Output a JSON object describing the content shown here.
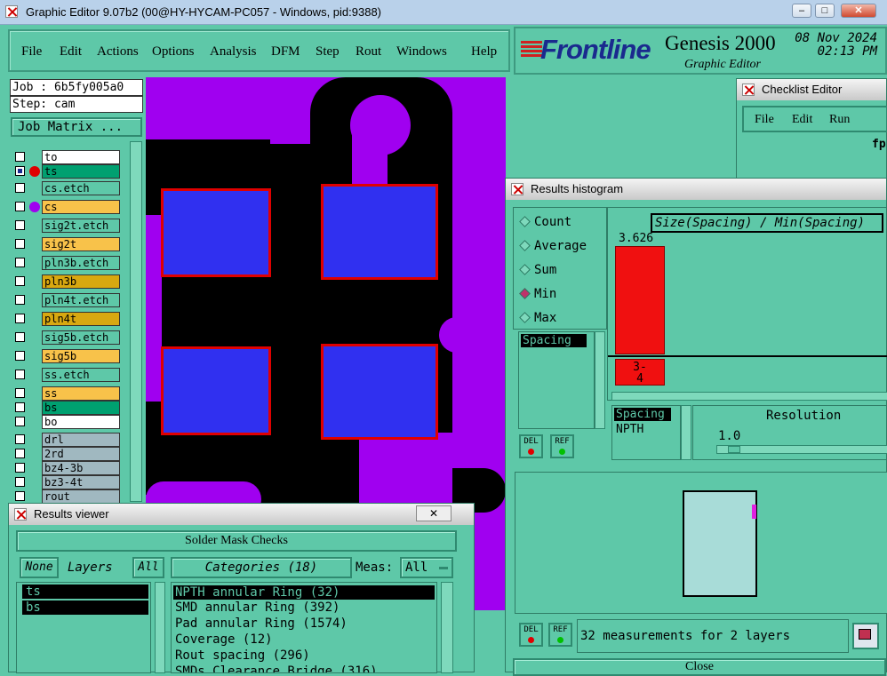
{
  "window": {
    "title": "Graphic Editor 9.07b2 (00@HY-HYCAM-PC057 - Windows, pid:9388)"
  },
  "menu": {
    "items": [
      "File",
      "Edit",
      "Actions",
      "Options",
      "Analysis",
      "DFM",
      "Step",
      "Rout",
      "Windows",
      "Help"
    ]
  },
  "brand": {
    "logo": "Frontline",
    "product": "Genesis 2000",
    "subtitle": "Graphic Editor",
    "date": "08 Nov 2024",
    "time": "02:13 PM"
  },
  "job": {
    "job_label": "Job : 6b5fy005a0",
    "step_label": "Step: cam",
    "matrix_button": "Job Matrix ..."
  },
  "layers": [
    {
      "name": "to",
      "color": "#ffffff"
    },
    {
      "name": "ts",
      "color": "#00a070",
      "active": true,
      "dot": "#e00000"
    },
    {
      "name": "cs.etch",
      "color": "#5ec8a8"
    },
    {
      "name": "cs",
      "color": "#f8c24a",
      "dot": "#a000f0"
    },
    {
      "name": "sig2t.etch",
      "color": "#5ec8a8"
    },
    {
      "name": "sig2t",
      "color": "#f8c24a"
    },
    {
      "name": "pln3b.etch",
      "color": "#5ec8a8"
    },
    {
      "name": "pln3b",
      "color": "#d8a810"
    },
    {
      "name": "pln4t.etch",
      "color": "#5ec8a8"
    },
    {
      "name": "pln4t",
      "color": "#d8a810"
    },
    {
      "name": "sig5b.etch",
      "color": "#5ec8a8"
    },
    {
      "name": "sig5b",
      "color": "#f8c24a"
    },
    {
      "name": "ss.etch",
      "color": "#5ec8a8"
    },
    {
      "name": "ss",
      "color": "#f8c24a"
    },
    {
      "name": "bs",
      "color": "#00a070"
    },
    {
      "name": "bo",
      "color": "#ffffff"
    },
    {
      "name": "drl",
      "color": "#a0b8c0"
    },
    {
      "name": "2rd",
      "color": "#a0b8c0"
    },
    {
      "name": "bz4-3b",
      "color": "#a0b8c0"
    },
    {
      "name": "bz3-4t",
      "color": "#a0b8c0"
    },
    {
      "name": "rout",
      "color": "#a0b8c0"
    }
  ],
  "checklist": {
    "title": "Checklist Editor",
    "menu": [
      "File",
      "Edit",
      "Run"
    ],
    "partial_label": "fp-"
  },
  "histogram": {
    "title": "Results histogram",
    "modes": [
      {
        "label": "Count",
        "on": false
      },
      {
        "label": "Average",
        "on": false
      },
      {
        "label": "Sum",
        "on": false
      },
      {
        "label": "Min",
        "on": true
      },
      {
        "label": "Max",
        "on": false
      }
    ],
    "list_item": "Spacing",
    "chart_title": "Size(Spacing) / Min(Spacing)",
    "bar_value": "3.626",
    "bar_range": "3-\n4",
    "params": [
      "Spacing",
      "NPTH"
    ],
    "resolution_label": "Resolution",
    "resolution_value": "1.0",
    "del": "DEL",
    "ref": "REF",
    "status": "32 measurements for 2 layers",
    "close": "Close"
  },
  "viewer": {
    "title": "Results viewer",
    "group": "Solder Mask Checks",
    "none_btn": "None",
    "layers_label": "Layers",
    "all_btn": "All",
    "layers": [
      "ts",
      "bs"
    ],
    "categories_label": "Categories (18)",
    "meas_label": "Meas:",
    "meas_value": "All",
    "categories": [
      "NPTH annular Ring (32)",
      "SMD annular Ring (392)",
      "Pad annular Ring (1574)",
      "Coverage (12)",
      "Rout spacing (296)",
      "SMDs Clearance Bridge (316)"
    ]
  }
}
